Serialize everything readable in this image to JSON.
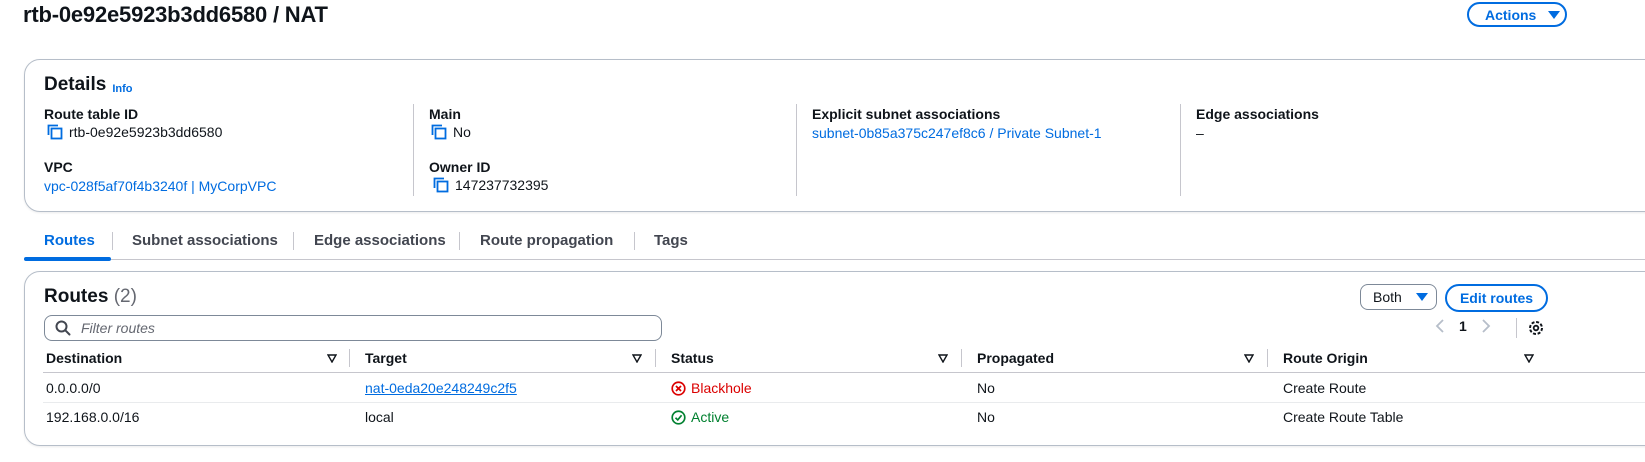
{
  "header": {
    "title": "rtb-0e92e5923b3dd6580 / NAT",
    "actions_label": "Actions"
  },
  "details": {
    "heading": "Details",
    "info_label": "Info",
    "route_table_id_label": "Route table ID",
    "route_table_id_value": "rtb-0e92e5923b3dd6580",
    "vpc_label": "VPC",
    "vpc_value": "vpc-028f5af70f4b3240f | MyCorpVPC",
    "main_label": "Main",
    "main_value": "No",
    "owner_id_label": "Owner ID",
    "owner_id_value": "147237732395",
    "explicit_subnet_label": "Explicit subnet associations",
    "explicit_subnet_value": "subnet-0b85a375c247ef8c6 / Private Subnet-1",
    "edge_assoc_label": "Edge associations",
    "edge_assoc_value": "–"
  },
  "tabs": [
    {
      "label": "Routes",
      "active": true
    },
    {
      "label": "Subnet associations",
      "active": false
    },
    {
      "label": "Edge associations",
      "active": false
    },
    {
      "label": "Route propagation",
      "active": false
    },
    {
      "label": "Tags",
      "active": false
    }
  ],
  "routes": {
    "heading": "Routes",
    "count": "(2)",
    "filter_select_value": "Both",
    "edit_label": "Edit routes",
    "search_placeholder": "Filter routes",
    "page_number": "1",
    "columns": [
      "Destination",
      "Target",
      "Status",
      "Propagated",
      "Route Origin"
    ],
    "rows": [
      {
        "destination": "0.0.0.0/0",
        "target": "nat-0eda20e248249c2f5",
        "status": "Blackhole",
        "propagated": "No",
        "origin": "Create Route"
      },
      {
        "destination": "192.168.0.0/16",
        "target": "local",
        "status": "Active",
        "propagated": "No",
        "origin": "Create Route Table"
      }
    ]
  },
  "colors": {
    "accent": "#006ce0",
    "error": "#db0000",
    "success": "#00802f"
  }
}
